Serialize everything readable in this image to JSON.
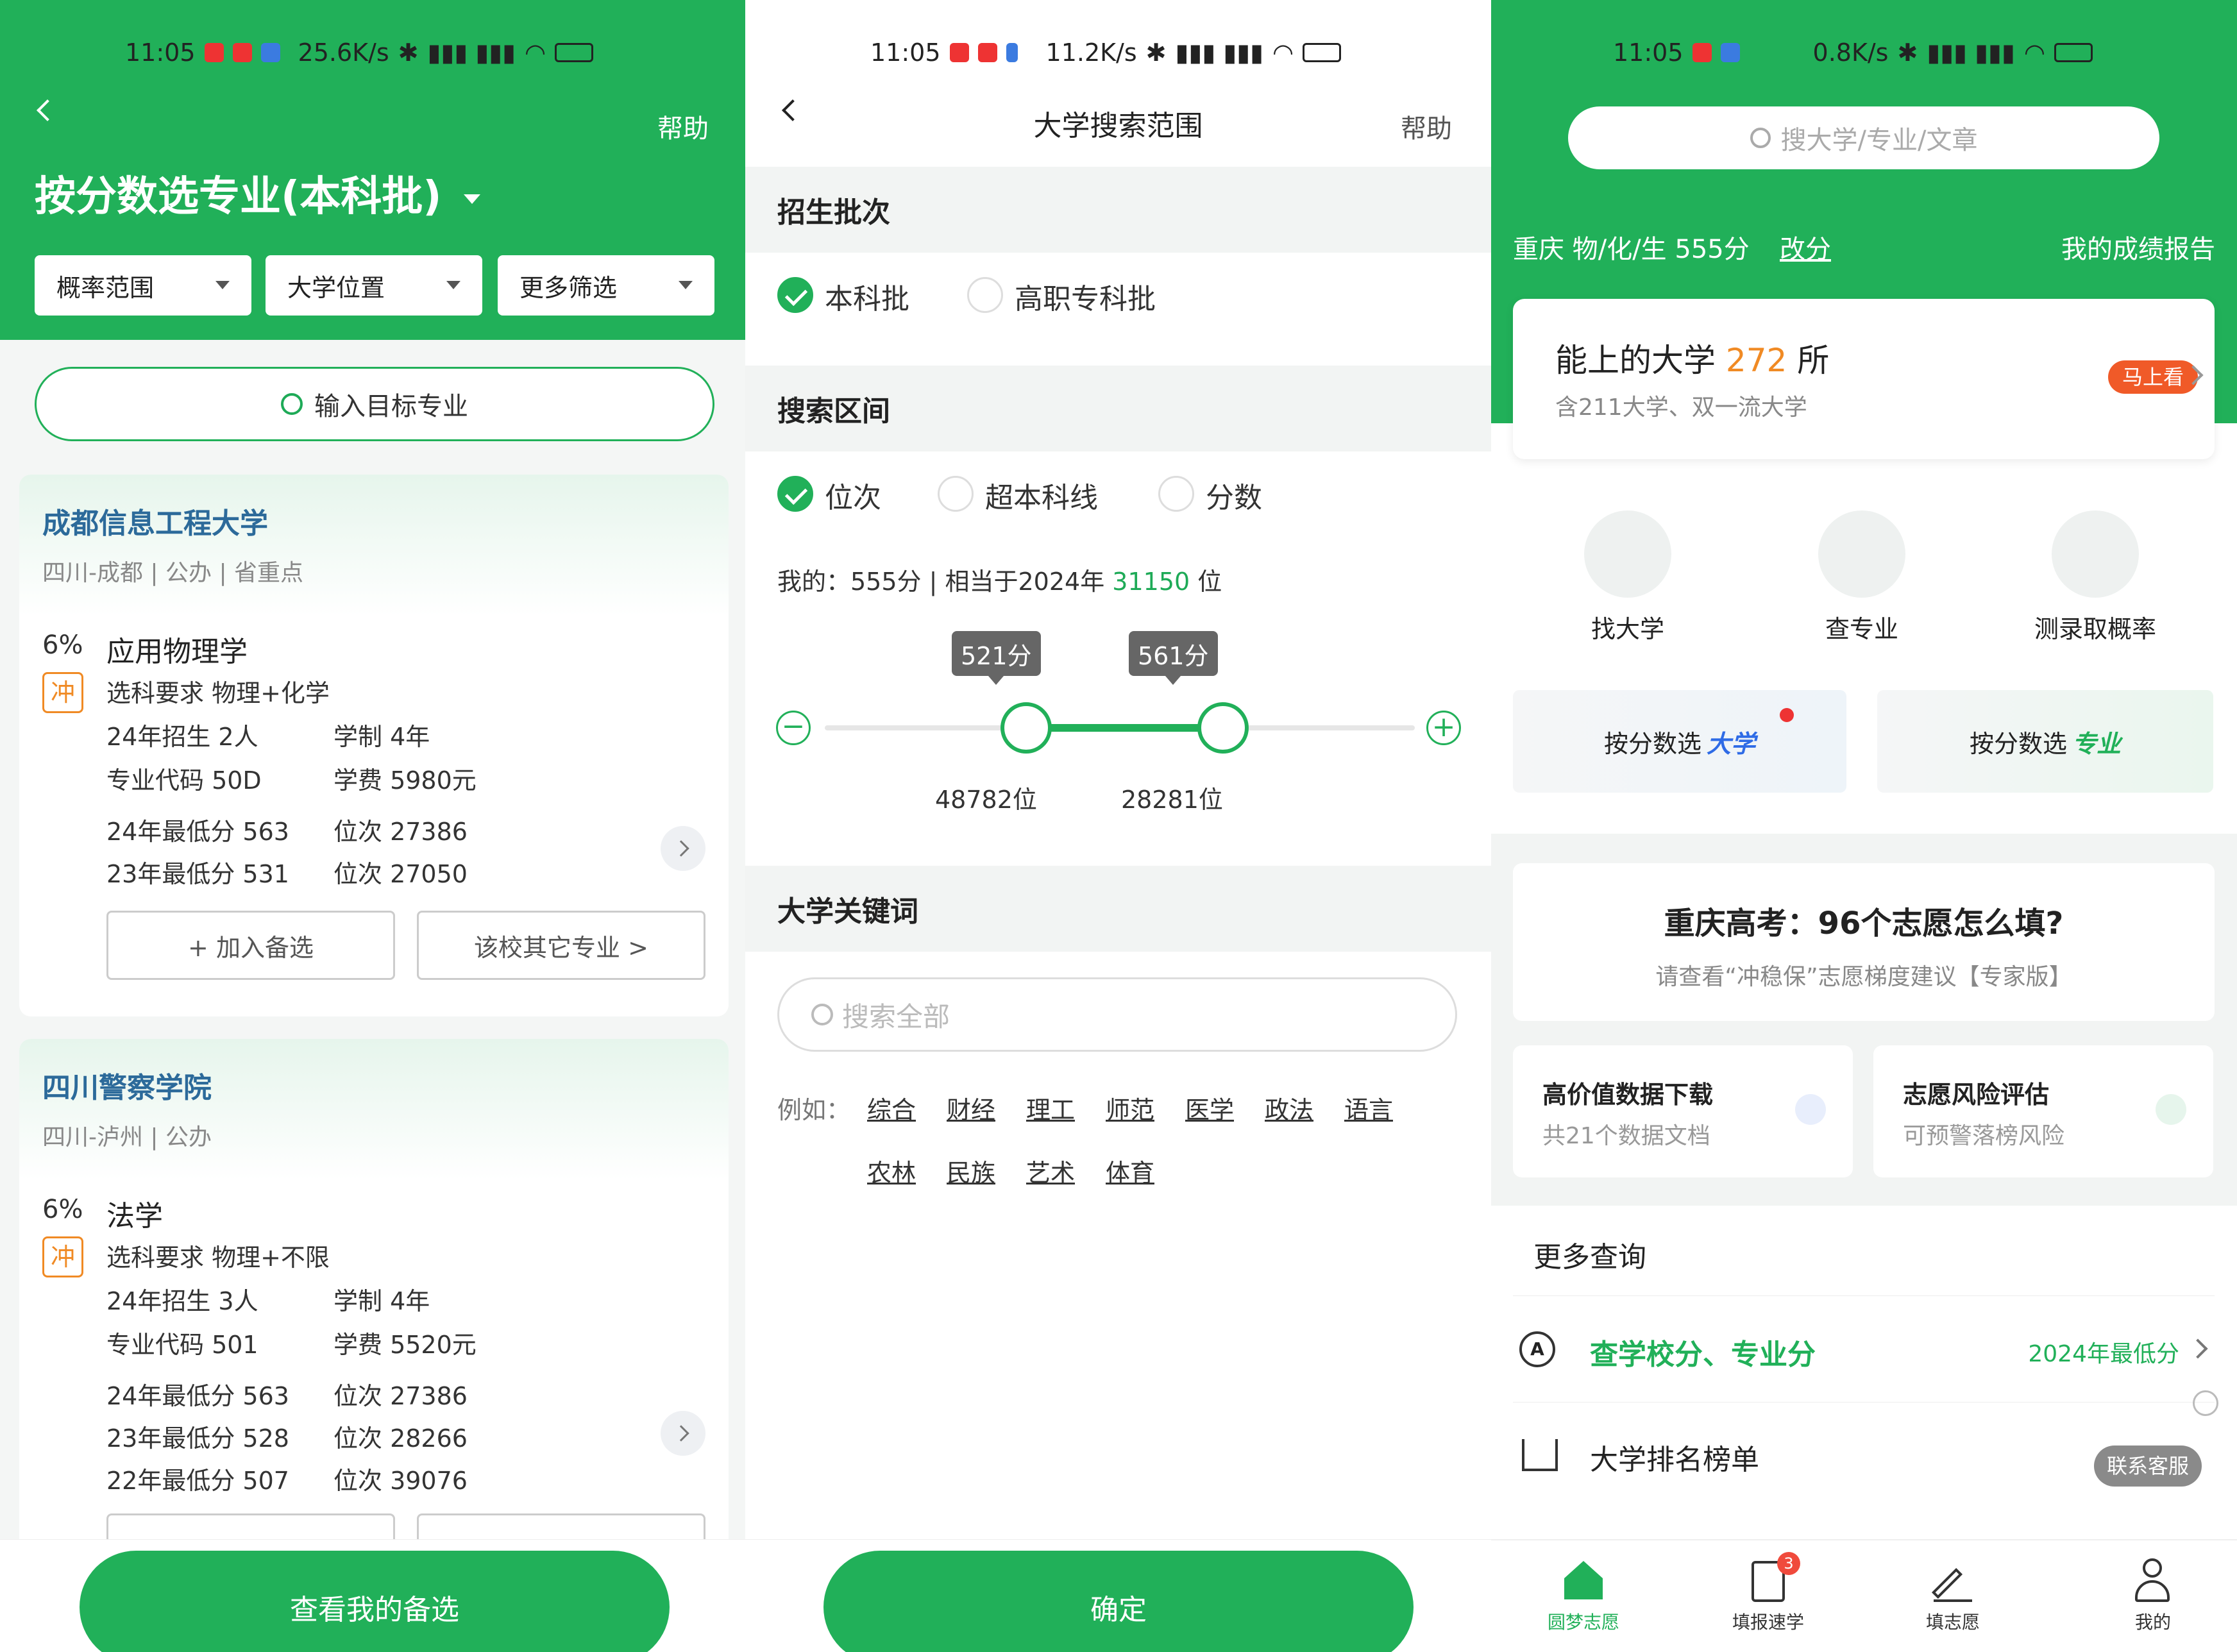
{
  "panel1": {
    "status": {
      "time": "11:05",
      "speed": "25.6K/s"
    },
    "help": "帮助",
    "title": "按分数选专业(本科批)",
    "filters": [
      "概率范围",
      "大学位置",
      "更多筛选"
    ],
    "search_placeholder": "输入目标专业",
    "cards": [
      {
        "name": "成都信息工程大学",
        "meta": "四川-成都 | 公办 | 省重点",
        "prob": "6%",
        "flag": "冲",
        "major": "应用物理学",
        "req": "选科要求 物理+化学",
        "enroll": "24年招生 2人",
        "years": "学制 4年",
        "code": "专业代码 50D",
        "fee": "学费 5980元",
        "scores": [
          {
            "s": "24年最低分 563",
            "r": "位次 27386"
          },
          {
            "s": "23年最低分 531",
            "r": "位次 27050"
          }
        ],
        "add": "+ 加入备选",
        "other": "该校其它专业 >"
      },
      {
        "name": "四川警察学院",
        "meta": "四川-泸州 | 公办",
        "prob": "6%",
        "flag": "冲",
        "major": "法学",
        "req": "选科要求 物理+不限",
        "enroll": "24年招生 3人",
        "years": "学制 4年",
        "code": "专业代码 501",
        "fee": "学费 5520元",
        "scores": [
          {
            "s": "24年最低分 563",
            "r": "位次 27386"
          },
          {
            "s": "23年最低分 528",
            "r": "位次 28266"
          },
          {
            "s": "22年最低分 507",
            "r": "位次 39076"
          }
        ]
      }
    ],
    "bottom_button": "查看我的备选"
  },
  "panel2": {
    "status": {
      "time": "11:05",
      "speed": "11.2K/s"
    },
    "title": "大学搜索范围",
    "help": "帮助",
    "batch_header": "招生批次",
    "batch_options": [
      {
        "label": "本科批",
        "checked": true
      },
      {
        "label": "高职专科批",
        "checked": false
      }
    ],
    "range_header": "搜索区间",
    "range_options": [
      {
        "label": "位次",
        "checked": true
      },
      {
        "label": "超本科线",
        "checked": false
      },
      {
        "label": "分数",
        "checked": false
      }
    ],
    "my_score_prefix": "我的：555分 | 相当于2024年",
    "my_rank": "31150",
    "my_rank_suffix": "位",
    "slider": {
      "low_label": "521分",
      "high_label": "561分",
      "low_rank": "48782位",
      "high_rank": "28281位",
      "min": 480,
      "max": 600,
      "low": 521,
      "high": 561
    },
    "keyword_header": "大学关键词",
    "keyword_placeholder": "搜索全部",
    "example_label": "例如：",
    "keywords": [
      "综合",
      "财经",
      "理工",
      "师范",
      "医学",
      "政法",
      "语言",
      "农林",
      "民族",
      "艺术",
      "体育"
    ],
    "confirm": "确定"
  },
  "panel3": {
    "status": {
      "time": "11:05",
      "speed": "0.8K/s"
    },
    "search_placeholder": "搜大学/专业/文章",
    "profile": "重庆 物/化/生 555分",
    "change": "改分",
    "report": "我的成绩报告",
    "can_go_prefix": "能上的大学",
    "can_go_count": "272",
    "can_go_suffix": "所",
    "can_go_sub": "含211大学、双一流大学",
    "can_go_badge": "马上看",
    "features": [
      "找大学",
      "查专业",
      "测录取概率"
    ],
    "promo1_text": "按分数选",
    "promo1_em": "大学",
    "promo2_text": "按分数选",
    "promo2_em": "专业",
    "banner_title": "重庆高考：96个志愿怎么填?",
    "banner_sub": "请查看“冲稳保”志愿梯度建议【专家版】",
    "tile1": {
      "title": "高价值数据下载",
      "sub": "共21个数据文档"
    },
    "tile2": {
      "title": "志愿风险评估",
      "sub": "可预警落榜风险"
    },
    "more_title": "更多查询",
    "query1": "查学校分、专业分",
    "query1_right": "2024年最低分",
    "query2": "大学排名榜单",
    "service": "联系客服",
    "tabs": [
      "圆梦志愿",
      "填报速学",
      "填志愿",
      "我的"
    ],
    "tab_badge": "3"
  },
  "colors": {
    "accent": "#21b059",
    "link": "#2c6a9a",
    "orange": "#f08a24"
  }
}
